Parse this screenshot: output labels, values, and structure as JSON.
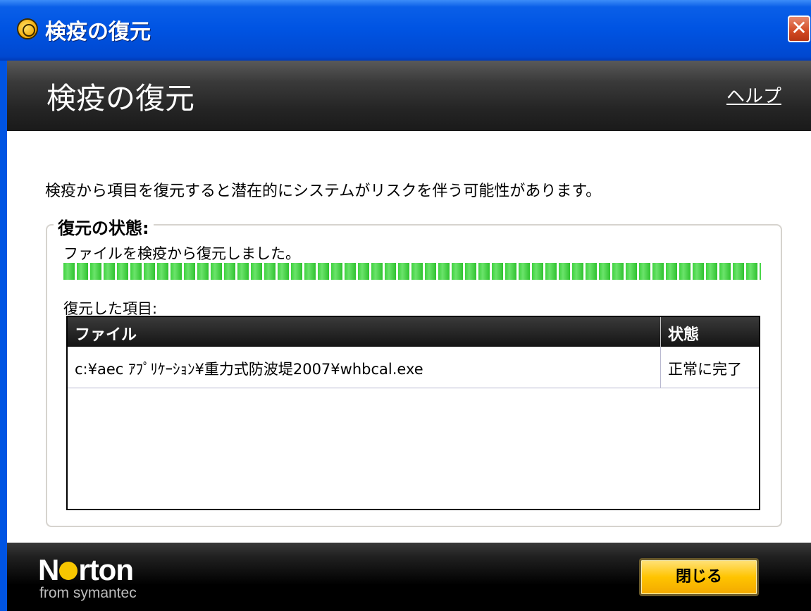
{
  "window": {
    "title": "検疫の復元",
    "close_symbol": "✕"
  },
  "header": {
    "title": "検疫の復元",
    "help_label": "ヘルプ"
  },
  "main": {
    "warning_text": "検疫から項目を復元すると潜在的にシステムがリスクを伴う可能性があります。",
    "group_title": "復元の状態:",
    "status_text": "ファイルを検疫から復元しました。",
    "progress_fraction": 1.0,
    "restored_items_label": "復元した項目:",
    "table": {
      "columns": [
        "ファイル",
        "状態"
      ],
      "rows": [
        [
          "c:¥aec ｱﾌﾟﾘｹｰｼｮﾝ¥重力式防波堤2007¥whbcal.exe",
          "正常に完了"
        ]
      ]
    }
  },
  "footer": {
    "logo_text_n": "N",
    "logo_text_rest": "rton",
    "logo_sub": "from symantec",
    "close_button_label": "閉じる"
  },
  "colors": {
    "titlebar_blue": "#0054e3",
    "progress_green": "#3fd23f",
    "button_yellow": "#ffc400"
  },
  "icons": {
    "window_icon": "norton-globe-icon",
    "close_icon": "close-x-icon"
  }
}
